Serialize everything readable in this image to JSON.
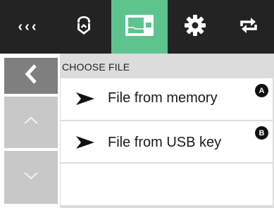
{
  "toolbar": {
    "items": [
      {
        "id": "back-menu",
        "label": "‹‹‹",
        "icon": "triple-chevron-left-icon"
      },
      {
        "id": "service",
        "icon": "wrench-shield-icon"
      },
      {
        "id": "file",
        "icon": "file-folder-icon",
        "active": true
      },
      {
        "id": "settings",
        "icon": "gear-icon"
      },
      {
        "id": "rotate",
        "icon": "rotate-arrows-icon"
      }
    ],
    "active_color": "#5ec48f",
    "background": "#232323"
  },
  "header": {
    "title": "CHOOSE FILE"
  },
  "file_options": [
    {
      "label": "File from memory",
      "badge": "A"
    },
    {
      "label": "File from USB key",
      "badge": "B"
    }
  ],
  "left_nav": {
    "back_icon": "chevron-left-icon",
    "up_icon": "chevron-up-icon",
    "down_icon": "chevron-down-icon"
  }
}
